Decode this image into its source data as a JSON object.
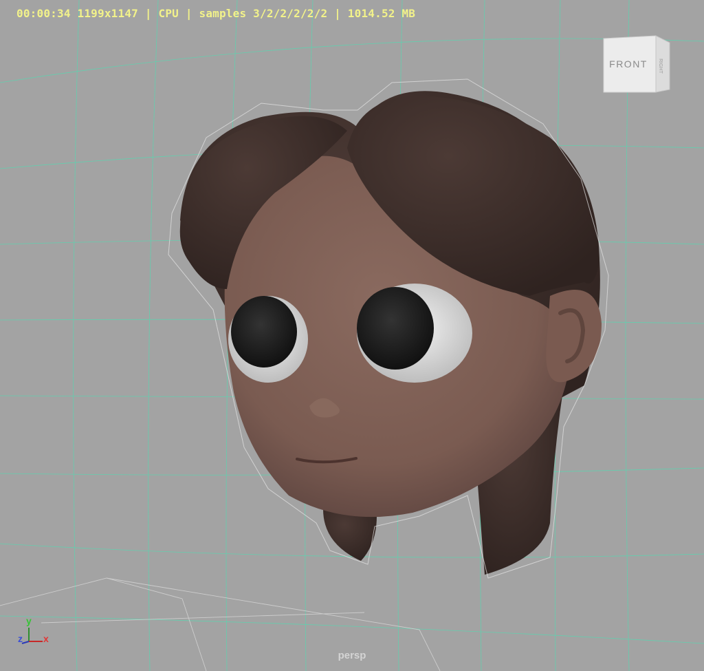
{
  "viewport": {
    "hud_text": "00:00:34 1199x1147 | CPU | samples 3/2/2/2/2/2 | 1014.52 MB",
    "camera_label": "persp",
    "background_color": "#a3a3a3",
    "grid_color": "#59d6b0",
    "hud_color": "#f2f28a"
  },
  "view_cube": {
    "front_label": "FRONT",
    "right_label": "RIGHT"
  },
  "axis_indicator": {
    "y_label": "y",
    "z_label": "z",
    "x_label": "x"
  },
  "model": {
    "description_icon": "cartoon-girl-head-render",
    "skin_color": "#7d5e54",
    "hair_color": "#3c2d29",
    "eye_white_color": "#e8e8e8",
    "pupil_color": "#1e1e1e"
  }
}
